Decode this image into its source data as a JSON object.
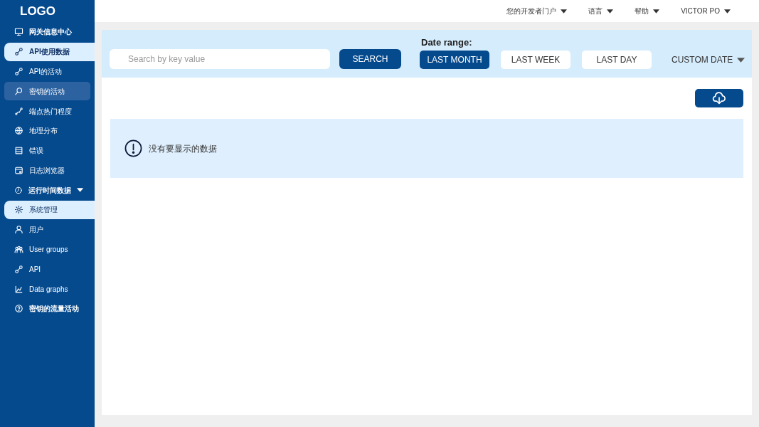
{
  "sidebar": {
    "logo": "LOGO",
    "items": [
      {
        "label": "网关信息中心",
        "bold": true,
        "selected": false,
        "highlighted": false
      },
      {
        "label": "API使用数据",
        "bold": true,
        "selected": true,
        "highlighted": false
      },
      {
        "label": "API的活动",
        "bold": false,
        "selected": false,
        "highlighted": false
      },
      {
        "label": "密钥的活动",
        "bold": false,
        "selected": false,
        "highlighted": true
      },
      {
        "label": "端点热门程度",
        "bold": false,
        "selected": false,
        "highlighted": false
      },
      {
        "label": "地理分布",
        "bold": false,
        "selected": false,
        "highlighted": false
      },
      {
        "label": "错误",
        "bold": false,
        "selected": false,
        "highlighted": false
      },
      {
        "label": "日志浏览器",
        "bold": false,
        "selected": false,
        "highlighted": false
      },
      {
        "label": "运行时间数据",
        "bold": true,
        "selected": false,
        "highlighted": false,
        "dropdown": true
      },
      {
        "label": "系统管理",
        "bold": false,
        "selected": true,
        "highlighted": false
      },
      {
        "label": "用户",
        "bold": false,
        "selected": false,
        "highlighted": false
      },
      {
        "label": "User groups",
        "bold": false,
        "selected": false,
        "highlighted": false
      },
      {
        "label": "API",
        "bold": false,
        "selected": false,
        "highlighted": false
      },
      {
        "label": "Data graphs",
        "bold": false,
        "selected": false,
        "highlighted": false
      },
      {
        "label": "密钥的流量活动",
        "bold": true,
        "selected": false,
        "highlighted": false
      }
    ]
  },
  "top_menu": [
    "您的开发者门户",
    "语言",
    "帮助",
    "VICTOR PO"
  ],
  "filter": {
    "search": {
      "placeholder": "Search by key value"
    },
    "search_button": "SEARCH",
    "date_range_label": "Date range:",
    "ranges": [
      {
        "label": "LAST MONTH",
        "selected": true
      },
      {
        "label": "LAST WEEK",
        "selected": false
      },
      {
        "label": "LAST DAY",
        "selected": false
      }
    ],
    "custom_date": "CUSTOM DATE"
  },
  "empty_message": "没有要显示的数据"
}
